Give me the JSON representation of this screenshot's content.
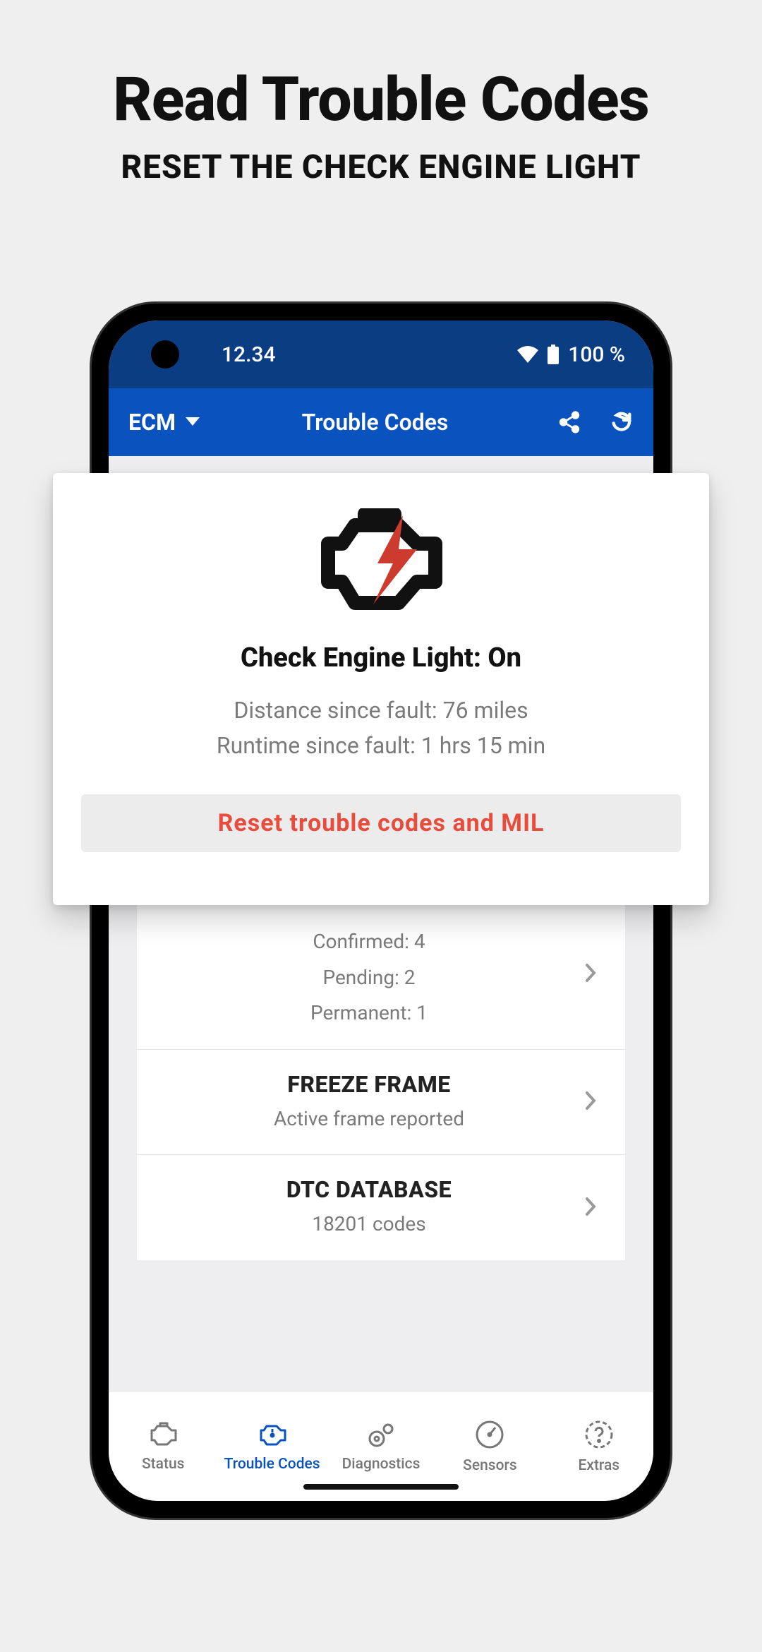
{
  "promo": {
    "title": "Read Trouble Codes",
    "subtitle": "RESET THE CHECK ENGINE LIGHT"
  },
  "status_bar": {
    "clock": "12.34",
    "battery": "100 %"
  },
  "app_bar": {
    "module": "ECM",
    "title": "Trouble Codes"
  },
  "popover": {
    "status": "Check Engine Light: On",
    "distance": "Distance since fault: 76 miles",
    "runtime": "Runtime since fault: 1 hrs 15 min",
    "reset_label": "Reset trouble codes and MIL"
  },
  "rows": {
    "summary": {
      "confirmed": "Confirmed: 4",
      "pending": "Pending: 2",
      "permanent": "Permanent: 1"
    },
    "freeze": {
      "title": "FREEZE FRAME",
      "sub": "Active frame reported"
    },
    "database": {
      "title": "DTC DATABASE",
      "sub": "18201 codes"
    }
  },
  "nav": {
    "status": "Status",
    "trouble": "Trouble Codes",
    "diag": "Diagnostics",
    "sensors": "Sensors",
    "extras": "Extras"
  }
}
